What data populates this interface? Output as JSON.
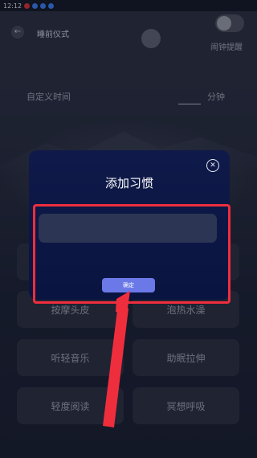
{
  "status_bar": {
    "time": "12:12"
  },
  "header": {
    "title": "睡前仪式",
    "back_icon": "arrow-left-icon"
  },
  "reminder": {
    "label": "闹钟提醒",
    "enabled": false
  },
  "custom_time": {
    "label": "自定义时间",
    "minute_value": "",
    "unit": "分钟"
  },
  "habits": [
    {
      "label": "按摩头皮"
    },
    {
      "label": "泡热水澡"
    },
    {
      "label": "听轻音乐"
    },
    {
      "label": "助眠拉伸"
    },
    {
      "label": "轻度阅读"
    },
    {
      "label": "冥想呼吸"
    }
  ],
  "dialog": {
    "title": "添加习惯",
    "input_value": "",
    "input_placeholder": "",
    "confirm_label": "确定",
    "close_icon": "close-icon"
  },
  "annotation": {
    "highlight_color": "#ef2e3d",
    "arrow_color": "#ef2e3d"
  }
}
